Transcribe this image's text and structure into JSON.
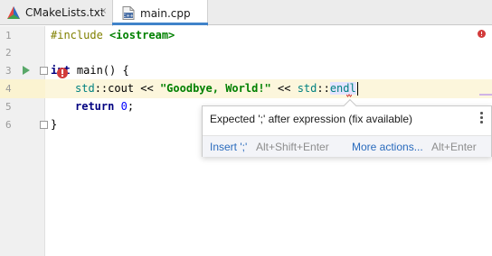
{
  "tabs": [
    {
      "label": "CMakeLists.txt",
      "close": "×"
    },
    {
      "label": "main.cpp"
    }
  ],
  "gutter": {
    "line_numbers": [
      "1",
      "2",
      "3",
      "4",
      "5",
      "6"
    ]
  },
  "code": {
    "line1": {
      "directive": "#include",
      "target": "<iostream>"
    },
    "line3": {
      "keyword": "int",
      "rest": " main() {"
    },
    "line4": {
      "ns1": "std",
      "sep1": "::",
      "ident1": "cout",
      "op1": " << ",
      "string": "\"Goodbye, World!\"",
      "op2": " << ",
      "ns2": "std",
      "sep2": "::",
      "endl": "endl"
    },
    "line5": {
      "keyword": "return",
      "space": " ",
      "number": "0",
      "semi": ";"
    },
    "line6": {
      "text": "}"
    }
  },
  "popup": {
    "message": "Expected ';' after expression (fix available)",
    "actions": [
      {
        "label": "Insert ';'",
        "shortcut": "Alt+Shift+Enter"
      },
      {
        "label": "More actions...",
        "shortcut": "Alt+Enter"
      }
    ]
  },
  "colors": {
    "accent": "#4083c9",
    "error": "#d23b3b",
    "run": "#59a869",
    "link": "#2a6bbd",
    "current_line": "#fcf6dc"
  }
}
